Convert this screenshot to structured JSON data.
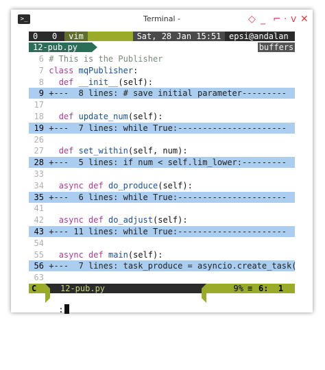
{
  "window": {
    "title": "Terminal -",
    "controls": [
      "◇",
      "_",
      "⌐",
      "·",
      "v",
      "✕"
    ]
  },
  "tabline": {
    "tab_num_1": "0",
    "tab_num_2": "0",
    "mode": "vim",
    "date": "Sat, 28 Jan 15:51",
    "host": "epsi@andalan"
  },
  "bufferline": {
    "file": "12-pub.py",
    "right": "buffers"
  },
  "code_lines": [
    {
      "n": "6",
      "text": "# This is the Publisher",
      "kind": "comment"
    },
    {
      "n": "7",
      "text": "class mqPublisher:",
      "kind": "class"
    },
    {
      "n": "8",
      "text": "  def __init__(self):",
      "kind": "def"
    },
    {
      "n": "9",
      "text": "+---  8 lines: # save initial parameter---------",
      "kind": "fold"
    },
    {
      "n": "17",
      "text": "",
      "kind": "blank"
    },
    {
      "n": "18",
      "text": "  def update_num(self):",
      "kind": "def"
    },
    {
      "n": "19",
      "text": "+---  7 lines: while True:----------------------",
      "kind": "fold"
    },
    {
      "n": "26",
      "text": "",
      "kind": "blank"
    },
    {
      "n": "27",
      "text": "  def set_within(self, num):",
      "kind": "def"
    },
    {
      "n": "28",
      "text": "+---  5 lines: if num < self.lim_lower:---------",
      "kind": "fold"
    },
    {
      "n": "33",
      "text": "",
      "kind": "blank"
    },
    {
      "n": "34",
      "text": "  async def do_produce(self):",
      "kind": "async"
    },
    {
      "n": "35",
      "text": "+---  6 lines: while True:----------------------",
      "kind": "fold"
    },
    {
      "n": "41",
      "text": "",
      "kind": "blank"
    },
    {
      "n": "42",
      "text": "  async def do_adjust(self):",
      "kind": "async"
    },
    {
      "n": "43",
      "text": "+--- 11 lines: while True:----------------------",
      "kind": "fold"
    },
    {
      "n": "54",
      "text": "",
      "kind": "blank"
    },
    {
      "n": "55",
      "text": "  async def main(self):",
      "kind": "async"
    },
    {
      "n": "56",
      "text": "+---  7 lines: task_produce = asyncio.create_task(",
      "kind": "fold"
    },
    {
      "n": "63",
      "text": "",
      "kind": "blank"
    }
  ],
  "statusline": {
    "mode": "C",
    "file": "12-pub.py",
    "percent": "9%",
    "position": "6:  1"
  },
  "cmdline": {
    "text": ":"
  }
}
